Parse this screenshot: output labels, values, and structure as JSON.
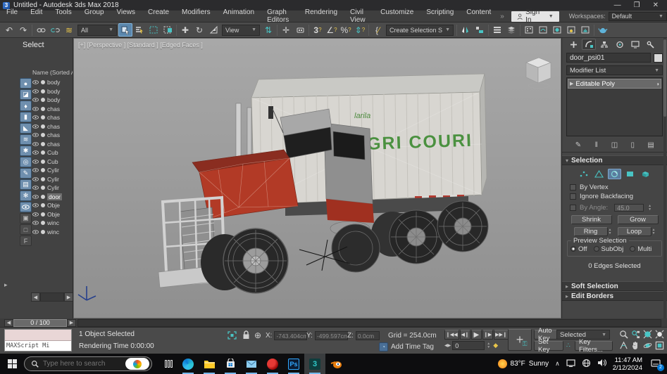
{
  "window": {
    "title": "Untitled - Autodesk 3ds Max 2018"
  },
  "menubar": {
    "items": [
      "File",
      "Edit",
      "Tools",
      "Group",
      "Views",
      "Create",
      "Modifiers",
      "Animation",
      "Graph Editors",
      "Rendering",
      "Civil View",
      "Customize",
      "Scripting",
      "Content"
    ]
  },
  "topbar": {
    "sign_in": "Sign In",
    "workspaces_label": "Workspaces:",
    "workspace_value": "Default"
  },
  "toolbar": {
    "filter_value": "All",
    "coord_value": "View",
    "named_set_value": "Create Selection Se"
  },
  "explorer": {
    "title": "Select",
    "column_header": "Name (Sorted A",
    "items": [
      {
        "name": "body",
        "selected": false
      },
      {
        "name": "body",
        "selected": false
      },
      {
        "name": "body",
        "selected": false
      },
      {
        "name": "chas",
        "selected": false
      },
      {
        "name": "chas",
        "selected": false
      },
      {
        "name": "chas",
        "selected": false
      },
      {
        "name": "chas",
        "selected": false
      },
      {
        "name": "chas",
        "selected": false
      },
      {
        "name": "Cub",
        "selected": false
      },
      {
        "name": "Cub",
        "selected": false
      },
      {
        "name": "Cylir",
        "selected": false
      },
      {
        "name": "Cylir",
        "selected": false
      },
      {
        "name": "Cylir",
        "selected": false
      },
      {
        "name": "door",
        "selected": true
      },
      {
        "name": "Obje",
        "selected": false
      },
      {
        "name": "Obje",
        "selected": false
      },
      {
        "name": "winc",
        "selected": false
      },
      {
        "name": "winc",
        "selected": false
      }
    ]
  },
  "viewport": {
    "label": "[+] [Perspective ] [Standard ] [Edged Faces ]",
    "trailer_brand": "larila",
    "trailer_text": "AGRI COURI"
  },
  "panel": {
    "object_name": "door_psi01",
    "modifier_list": "Modifier List",
    "stack_item": "Editable Poly",
    "selection_title": "Selection",
    "by_vertex": "By Vertex",
    "ignore_backfacing": "Ignore Backfacing",
    "by_angle": "By Angle:",
    "by_angle_value": "45.0",
    "shrink": "Shrink",
    "grow": "Grow",
    "ring": "Ring",
    "loop": "Loop",
    "preview_title": "Preview Selection",
    "preview_off": "Off",
    "preview_subobj": "SubObj",
    "preview_multi": "Multi",
    "status": "0 Edges Selected",
    "rollout_soft": "Soft Selection",
    "rollout_edit": "Edit Borders"
  },
  "statusbar": {
    "time_slider": "0 / 100",
    "maxscript_text": "MAXScript Mi",
    "status_line": "1 Object Selected",
    "prompt_line": "Rendering Time  0:00:00",
    "x_label": "X:",
    "x_value": "-743.404cm",
    "y_label": "Y:",
    "y_value": "-499.597cm",
    "z_label": "Z:",
    "z_value": "0.0cm",
    "grid": "Grid = 254.0cm",
    "add_time_tag": "Add Time Tag",
    "frame_value": "0",
    "auto_key": "Auto Key",
    "set_key": "Set Key",
    "selected_filter": "Selected",
    "key_filters": "Key Filters..."
  },
  "taskbar": {
    "search_placeholder": "Type here to search",
    "weather_temp": "83°F",
    "weather_cond": "Sunny",
    "clock_time": "11:47 AM",
    "clock_date": "2/12/2024",
    "notif_count": "2"
  }
}
